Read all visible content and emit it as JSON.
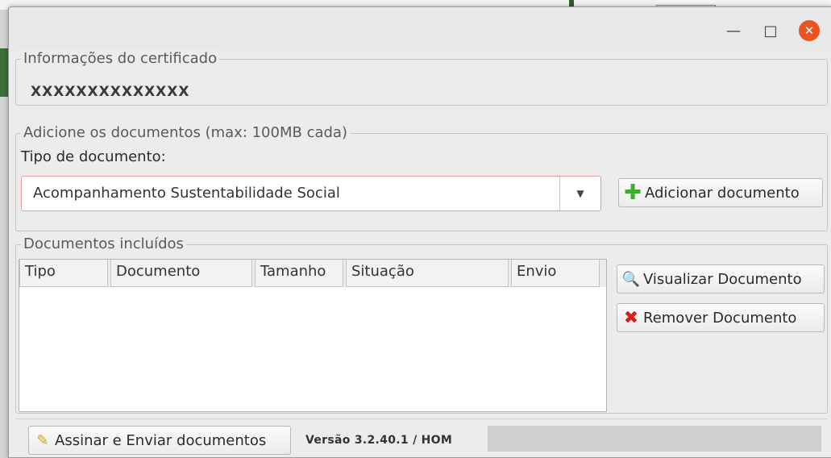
{
  "window": {
    "minimize_icon": "minimize-icon",
    "maximize_icon": "maximize-icon",
    "close_icon": "close-icon"
  },
  "certificate": {
    "legend": "Informações do certificado",
    "value": "XXXXXXXXXXXXXX"
  },
  "add_section": {
    "legend": "Adicione os  documentos (max: 100MB cada)",
    "type_label": "Tipo de documento:",
    "selected_type": "Acompanhamento Sustentabilidade Social",
    "add_button_label": "Adicionar documento"
  },
  "documents": {
    "legend": "Documentos incluídos",
    "columns": [
      "Tipo",
      "Documento",
      "Tamanho",
      "Situação",
      "Envio"
    ],
    "rows": [],
    "view_button_label": "Visualizar Documento",
    "remove_button_label": "Remover Documento"
  },
  "footer": {
    "sign_button_label": "Assinar e Enviar documentos",
    "version": "Versão 3.2.40.1 / HOM",
    "progress": 0
  },
  "colors": {
    "close_button": "#e95420",
    "add_icon": "#3bb12e",
    "remove_icon": "#d42020"
  }
}
